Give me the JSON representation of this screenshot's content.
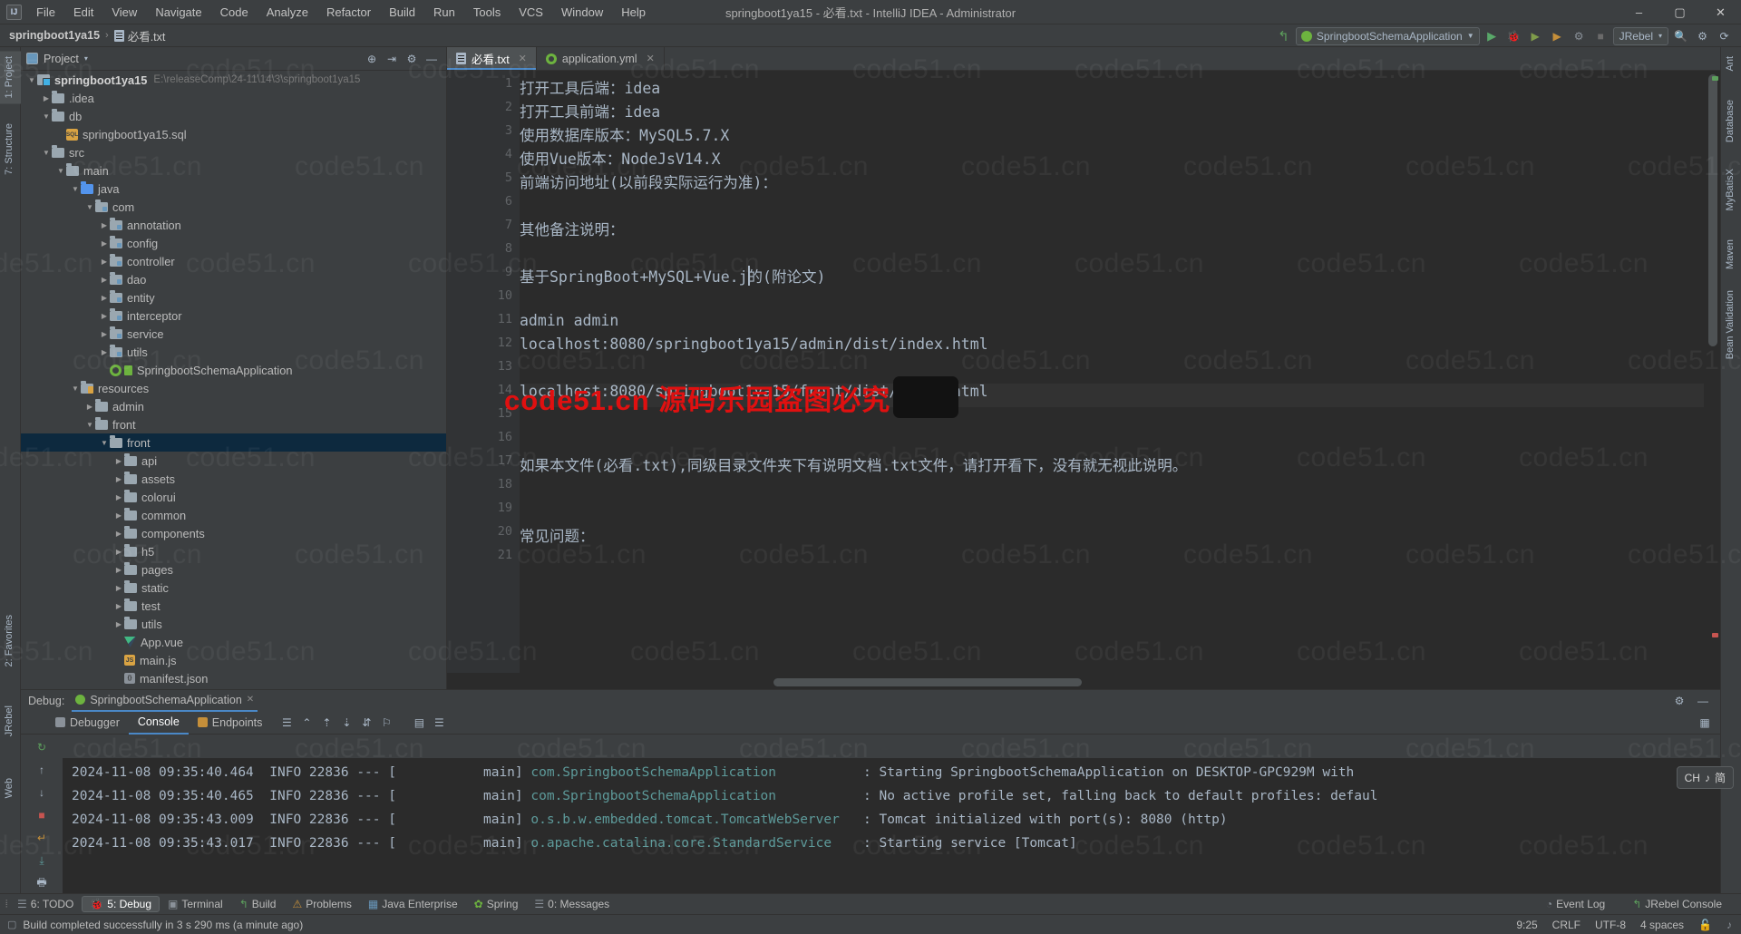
{
  "window": {
    "title": "springboot1ya15 - 必看.txt - IntelliJ IDEA - Administrator",
    "logo": "IJ",
    "minimize": "–",
    "maximize": "▢",
    "close": "✕"
  },
  "menubar": [
    {
      "label": "File"
    },
    {
      "label": "Edit"
    },
    {
      "label": "View"
    },
    {
      "label": "Navigate"
    },
    {
      "label": "Code"
    },
    {
      "label": "Analyze"
    },
    {
      "label": "Refactor"
    },
    {
      "label": "Build"
    },
    {
      "label": "Run"
    },
    {
      "label": "Tools"
    },
    {
      "label": "VCS"
    },
    {
      "label": "Window"
    },
    {
      "label": "Help"
    }
  ],
  "navbar": {
    "project": "springboot1ya15",
    "separator": "›",
    "file": "必看.txt"
  },
  "toolbar": {
    "back_icon": "↰",
    "run_config": "SpringbootSchemaApplication",
    "run_icon": "▶",
    "debug_icon": "🐞",
    "run_with_coverage_icon": "▶",
    "profile_icon": "⏱",
    "attach_icon": "⚙",
    "stop_icon": "■",
    "jrebel_label": "JRebel",
    "jrebel_dropdown": "▾",
    "search_icon": "🔍",
    "settings_icon": "⚙",
    "update_icon": "⟳"
  },
  "left_strip": [
    {
      "label": "1: Project",
      "selected": true
    },
    {
      "label": "7: Structure",
      "selected": false
    },
    {
      "label": "2: Favorites",
      "selected": false
    },
    {
      "label": "JRebel",
      "selected": false
    },
    {
      "label": "Web",
      "selected": false
    }
  ],
  "right_strip": [
    {
      "label": "Ant"
    },
    {
      "label": "Database"
    },
    {
      "label": "MyBatisX"
    },
    {
      "label": "Maven"
    },
    {
      "label": "Bean Validation"
    }
  ],
  "project_panel": {
    "title": "Project",
    "dropdown": "▾",
    "actions": [
      "locate-icon",
      "collapse-icon",
      "settings-icon",
      "hide-icon"
    ],
    "tree": [
      {
        "depth": 0,
        "arrow": "▼",
        "icon": "module",
        "label": "springboot1ya15",
        "bold": true,
        "path": "E:\\releaseComp\\24-11\\14\\3\\springboot1ya15",
        "selected": false
      },
      {
        "depth": 1,
        "arrow": "▶",
        "icon": "folder",
        "label": ".idea",
        "selected": false
      },
      {
        "depth": 1,
        "arrow": "▼",
        "icon": "folder",
        "label": "db",
        "selected": false
      },
      {
        "depth": 2,
        "arrow": "",
        "icon": "sql",
        "label": "springboot1ya15.sql",
        "selected": false
      },
      {
        "depth": 1,
        "arrow": "▼",
        "icon": "folder",
        "label": "src",
        "selected": false
      },
      {
        "depth": 2,
        "arrow": "▼",
        "icon": "folder",
        "label": "main",
        "selected": false
      },
      {
        "depth": 3,
        "arrow": "▼",
        "icon": "folder-blue",
        "label": "java",
        "selected": false
      },
      {
        "depth": 4,
        "arrow": "▼",
        "icon": "pkg",
        "label": "com",
        "selected": false
      },
      {
        "depth": 5,
        "arrow": "▶",
        "icon": "pkg",
        "label": "annotation",
        "selected": false
      },
      {
        "depth": 5,
        "arrow": "▶",
        "icon": "pkg",
        "label": "config",
        "selected": false
      },
      {
        "depth": 5,
        "arrow": "▶",
        "icon": "pkg",
        "label": "controller",
        "selected": false
      },
      {
        "depth": 5,
        "arrow": "▶",
        "icon": "pkg",
        "label": "dao",
        "selected": false
      },
      {
        "depth": 5,
        "arrow": "▶",
        "icon": "pkg",
        "label": "entity",
        "selected": false
      },
      {
        "depth": 5,
        "arrow": "▶",
        "icon": "pkg",
        "label": "interceptor",
        "selected": false
      },
      {
        "depth": 5,
        "arrow": "▶",
        "icon": "pkg",
        "label": "service",
        "selected": false
      },
      {
        "depth": 5,
        "arrow": "▶",
        "icon": "pkg",
        "label": "utils",
        "selected": false
      },
      {
        "depth": 5,
        "arrow": "",
        "icon": "spring-class",
        "label": "SpringbootSchemaApplication",
        "selected": false
      },
      {
        "depth": 3,
        "arrow": "▼",
        "icon": "folder-res",
        "label": "resources",
        "selected": false
      },
      {
        "depth": 4,
        "arrow": "▶",
        "icon": "folder",
        "label": "admin",
        "selected": false
      },
      {
        "depth": 4,
        "arrow": "▼",
        "icon": "folder",
        "label": "front",
        "selected": false
      },
      {
        "depth": 5,
        "arrow": "▼",
        "icon": "folder",
        "label": "front",
        "selected": true
      },
      {
        "depth": 6,
        "arrow": "▶",
        "icon": "folder",
        "label": "api",
        "selected": false
      },
      {
        "depth": 6,
        "arrow": "▶",
        "icon": "folder",
        "label": "assets",
        "selected": false
      },
      {
        "depth": 6,
        "arrow": "▶",
        "icon": "folder",
        "label": "colorui",
        "selected": false
      },
      {
        "depth": 6,
        "arrow": "▶",
        "icon": "folder",
        "label": "common",
        "selected": false
      },
      {
        "depth": 6,
        "arrow": "▶",
        "icon": "folder",
        "label": "components",
        "selected": false
      },
      {
        "depth": 6,
        "arrow": "▶",
        "icon": "folder",
        "label": "h5",
        "selected": false
      },
      {
        "depth": 6,
        "arrow": "▶",
        "icon": "folder",
        "label": "pages",
        "selected": false
      },
      {
        "depth": 6,
        "arrow": "▶",
        "icon": "folder",
        "label": "static",
        "selected": false
      },
      {
        "depth": 6,
        "arrow": "▶",
        "icon": "folder",
        "label": "test",
        "selected": false
      },
      {
        "depth": 6,
        "arrow": "▶",
        "icon": "folder",
        "label": "utils",
        "selected": false
      },
      {
        "depth": 6,
        "arrow": "",
        "icon": "vue",
        "label": "App.vue",
        "selected": false
      },
      {
        "depth": 6,
        "arrow": "",
        "icon": "js",
        "label": "main.js",
        "selected": false
      },
      {
        "depth": 6,
        "arrow": "",
        "icon": "json",
        "label": "manifest.json",
        "selected": false
      }
    ]
  },
  "editor": {
    "tabs": [
      {
        "label": "必看.txt",
        "icon": "text-file-icon",
        "active": true,
        "close": "✕"
      },
      {
        "label": "application.yml",
        "icon": "spring-yaml-icon",
        "active": false,
        "close": "✕"
      }
    ],
    "line_numbers": [
      "1",
      "2",
      "3",
      "4",
      "5",
      "6",
      "7",
      "8",
      "9",
      "10",
      "11",
      "12",
      "13",
      "14",
      "15",
      "16",
      "17",
      "18",
      "19",
      "20",
      "21"
    ],
    "lines": [
      "打开工具后端：idea",
      "打开工具前端：idea",
      "使用数据库版本：MySQL5.7.X",
      "使用Vue版本：NodeJsV14.X",
      "前端访问地址(以前段实际运行为准)：",
      "",
      "其他备注说明：",
      "",
      "基于SpringBoot+MySQL+Vue.j的(附论文)",
      "",
      "admin admin",
      "localhost:8080/springboot1ya15/admin/dist/index.html",
      "",
      "localhost:8080/springboot1ya15/front/dist/index.html",
      "",
      "",
      "如果本文件(必看.txt),同级目录文件夹下有说明文档.txt文件，请打开看下，没有就无视此说明。",
      "",
      "",
      "常见问题：",
      ""
    ],
    "caret_line": 9,
    "caret_col_text": "基于SpringBoot+MySQL+Vue.j"
  },
  "watermarks": {
    "tile_text": "code51.cn",
    "red_text": "code51.cn 源码乐园盗图必究"
  },
  "debug": {
    "label": "Debug:",
    "config_name": "SpringbootSchemaApplication",
    "config_close": "✕",
    "tabs": [
      {
        "label": "Debugger",
        "icon": "debugger-icon",
        "active": false
      },
      {
        "label": "Console",
        "icon": "console-icon",
        "active": true
      },
      {
        "label": "Endpoints",
        "icon": "endpoints-icon",
        "active": false
      }
    ],
    "toolbar_icons": [
      "menu-icon",
      "layout-icon",
      "scroll-up-icon",
      "scroll-down-icon",
      "soft-wrap-icon",
      "print-icon",
      "filter-icon",
      "settings-icon"
    ],
    "side_icons": [
      "rerun-icon",
      "up-icon",
      "down-icon",
      "stop-icon",
      "restore-icon",
      "soft-wrap-icon",
      "scroll-end-icon",
      "print-icon",
      "trash-icon"
    ],
    "head_icons": [
      "settings-icon",
      "hide-icon"
    ],
    "console_lines": [
      {
        "time": "2024-11-08 09:35:40.464",
        "level": "INFO",
        "pid": "22836",
        "dash": "--- [",
        "thread": "           main]",
        "cls": "com.SpringbootSchemaApplication",
        "sep": ": ",
        "msg": "Starting SpringbootSchemaApplication on DESKTOP-GPC929M with"
      },
      {
        "time": "2024-11-08 09:35:40.465",
        "level": "INFO",
        "pid": "22836",
        "dash": "--- [",
        "thread": "           main]",
        "cls": "com.SpringbootSchemaApplication",
        "sep": ": ",
        "msg": "No active profile set, falling back to default profiles: defaul"
      },
      {
        "time": "2024-11-08 09:35:43.009",
        "level": "INFO",
        "pid": "22836",
        "dash": "--- [",
        "thread": "           main]",
        "cls": "o.s.b.w.embedded.tomcat.TomcatWebServer",
        "sep": ": ",
        "msg": "Tomcat initialized with port(s): 8080 (http)"
      },
      {
        "time": "2024-11-08 09:35:43.017",
        "level": "INFO",
        "pid": "22836",
        "dash": "--- [",
        "thread": "           main]",
        "cls": "o.apache.catalina.core.StandardService",
        "sep": ": ",
        "msg": "Starting service [Tomcat]"
      }
    ]
  },
  "toolwindow_bar": {
    "items": [
      {
        "label": "6: TODO",
        "icon": "todo-icon",
        "selected": false
      },
      {
        "label": "5: Debug",
        "icon": "debug-icon",
        "selected": true
      },
      {
        "label": "Terminal",
        "icon": "terminal-icon",
        "selected": false
      },
      {
        "label": "Build",
        "icon": "build-icon",
        "selected": false
      },
      {
        "label": "Problems",
        "icon": "problems-icon",
        "selected": false
      },
      {
        "label": "Java Enterprise",
        "icon": "java-enterprise-icon",
        "selected": false
      },
      {
        "label": "Spring",
        "icon": "spring-icon",
        "selected": false
      },
      {
        "label": "0: Messages",
        "icon": "messages-icon",
        "selected": false
      }
    ],
    "right": [
      {
        "label": "Event Log",
        "icon": "event-log-icon"
      },
      {
        "label": "JRebel Console",
        "icon": "jrebel-icon"
      }
    ]
  },
  "statusbar": {
    "message": "Build completed successfully in 3 s 290 ms (a minute ago)",
    "message_icon": "build-status-icon",
    "position": "9:25",
    "line_sep": "CRLF",
    "encoding": "UTF-8",
    "indent": "4 spaces",
    "lock_icon": "unlocked-icon",
    "event_icon": "event-icon"
  },
  "ime_popup": {
    "label": "CH",
    "mode": "简",
    "icon": "ime-icon"
  },
  "colors": {
    "accent": "#4a88c7",
    "selection": "#0d293e",
    "panel": "#3c3f41",
    "editor_bg": "#2b2b2b",
    "text": "#a9b7c6",
    "green": "#6db33f",
    "watermark_red": "#e01010"
  }
}
